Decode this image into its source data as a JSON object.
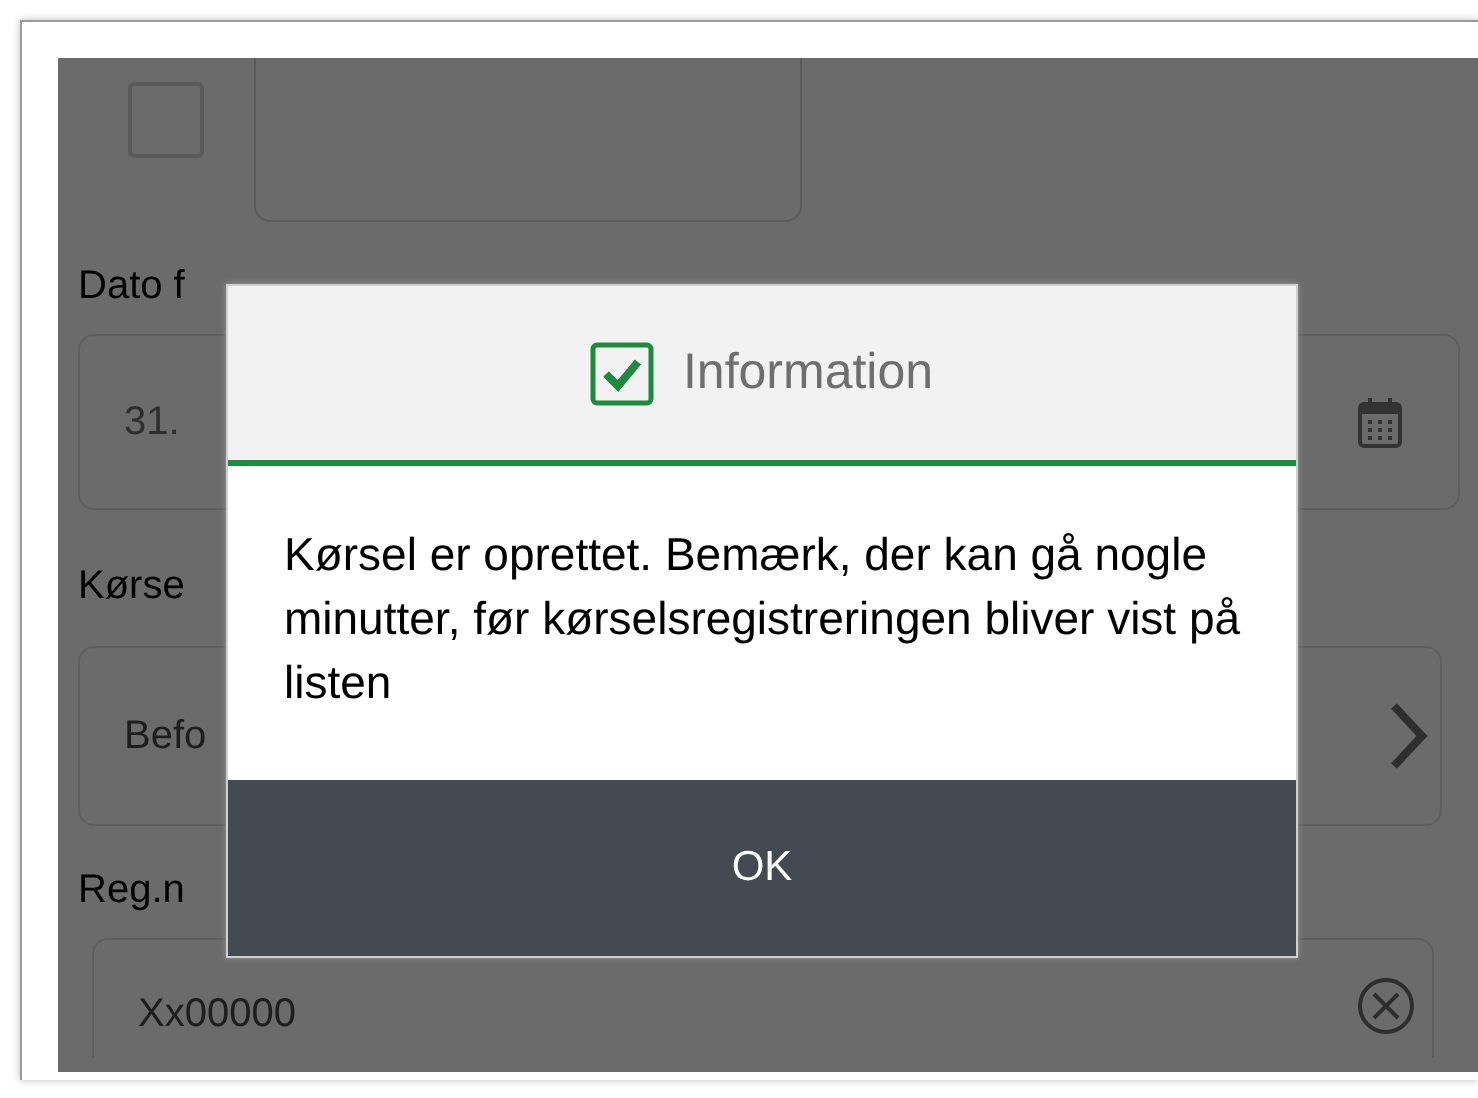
{
  "form": {
    "checkbox": {
      "checked": false
    },
    "date_label": "Dato f",
    "date_value": "31.",
    "type_label": "Kørse",
    "type_value": "Befo",
    "reg_label": "Reg.n",
    "reg_value": "Xx00000"
  },
  "dialog": {
    "title": "Information",
    "message": "Kørsel er oprettet. Bemærk, der kan gå nogle minutter, før kørselsregistreringen bliver vist på listen",
    "button": "OK"
  }
}
